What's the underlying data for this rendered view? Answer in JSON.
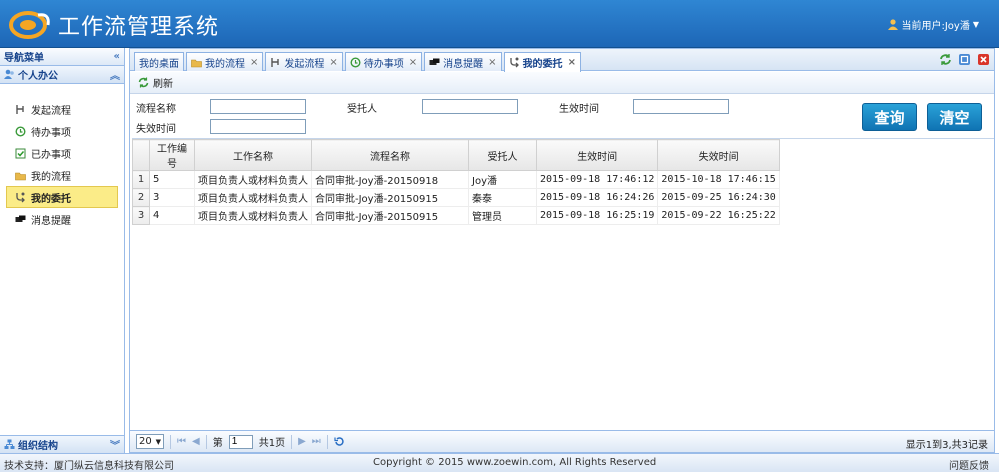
{
  "app": {
    "title": "工作流管理系统",
    "user_label": "当前用户:Joy潘"
  },
  "sidebar": {
    "header": "导航菜单",
    "group": "个人办公",
    "items": [
      {
        "label": "发起流程"
      },
      {
        "label": "待办事项"
      },
      {
        "label": "已办事项"
      },
      {
        "label": "我的流程"
      },
      {
        "label": "我的委托"
      },
      {
        "label": "消息提醒"
      }
    ],
    "bottom_group": "组织结构"
  },
  "tabs": [
    {
      "label": "我的桌面"
    },
    {
      "label": "我的流程"
    },
    {
      "label": "发起流程"
    },
    {
      "label": "待办事项"
    },
    {
      "label": "消息提醒"
    },
    {
      "label": "我的委托"
    }
  ],
  "toolbar": {
    "refresh_label": "刷新"
  },
  "form": {
    "process_name_label": "流程名称",
    "delegate_label": "受托人",
    "effective_time_label": "生效时间",
    "expire_time_label": "失效时间",
    "query_button": "查询",
    "clear_button": "清空"
  },
  "grid": {
    "columns": [
      "工作编号",
      "工作名称",
      "流程名称",
      "受托人",
      "生效时间",
      "失效时间"
    ],
    "rows": [
      {
        "rn": "1",
        "id": "5",
        "work": "项目负责人或材料负责人",
        "flow": "合同审批-Joy潘-20150918",
        "delegate": "Joy潘",
        "start": "2015-09-18 17:46:12",
        "end": "2015-10-18 17:46:15"
      },
      {
        "rn": "2",
        "id": "3",
        "work": "项目负责人或材料负责人",
        "flow": "合同审批-Joy潘-20150915",
        "delegate": "秦泰",
        "start": "2015-09-18 16:24:26",
        "end": "2015-09-25 16:24:30"
      },
      {
        "rn": "3",
        "id": "4",
        "work": "项目负责人或材料负责人",
        "flow": "合同审批-Joy潘-20150915",
        "delegate": "管理员",
        "start": "2015-09-18 16:25:19",
        "end": "2015-09-22 16:25:22"
      }
    ]
  },
  "pager": {
    "page_size": "20",
    "page_prefix": "第",
    "page_value": "1",
    "page_suffix": "共1页",
    "info": "显示1到3,共3记录"
  },
  "footer": {
    "support": "技术支持：厦门纵云信息科技有限公司",
    "copyright": "Copyright © 2015 www.zoewin.com, All Rights Reserved",
    "feedback": "问题反馈"
  },
  "colors": {
    "header": "#2f86d3",
    "accent": "#99bbe8",
    "button": "#1a8ac8",
    "active_item": "#fbec88"
  }
}
